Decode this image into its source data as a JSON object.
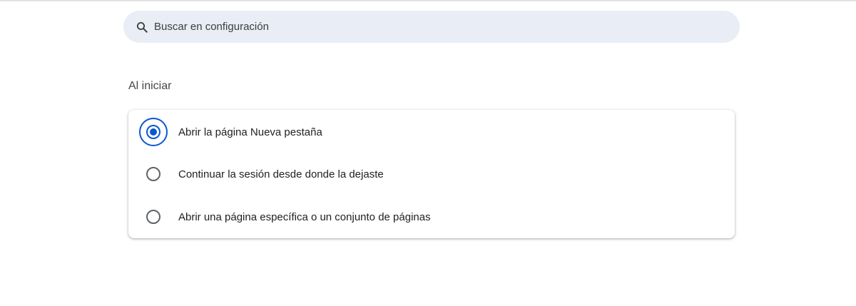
{
  "search": {
    "placeholder": "Buscar en configuración",
    "icon": "search-icon"
  },
  "on_startup": {
    "title": "Al iniciar",
    "options": [
      {
        "label": "Abrir la página Nueva pestaña",
        "selected": true
      },
      {
        "label": "Continuar la sesión desde donde la dejaste",
        "selected": false
      },
      {
        "label": "Abrir una página específica o un conjunto de páginas",
        "selected": false
      }
    ]
  },
  "colors": {
    "accent": "#0b57d0",
    "search_bg": "#e9eef6"
  }
}
